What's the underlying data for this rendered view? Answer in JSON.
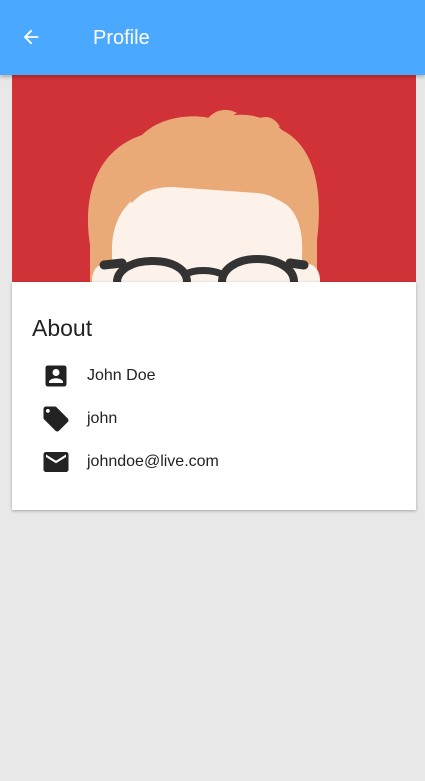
{
  "app_bar": {
    "title": "Profile",
    "background": "#4aa8ff",
    "back_icon": "arrow-left-icon"
  },
  "hero": {
    "background": "#d13237",
    "image": "avatar-illustration"
  },
  "about": {
    "title": "About",
    "items": [
      {
        "icon": "account-box-icon",
        "value": "John Doe"
      },
      {
        "icon": "tag-icon",
        "value": "john"
      },
      {
        "icon": "email-icon",
        "value": "johndoe@live.com"
      }
    ]
  }
}
